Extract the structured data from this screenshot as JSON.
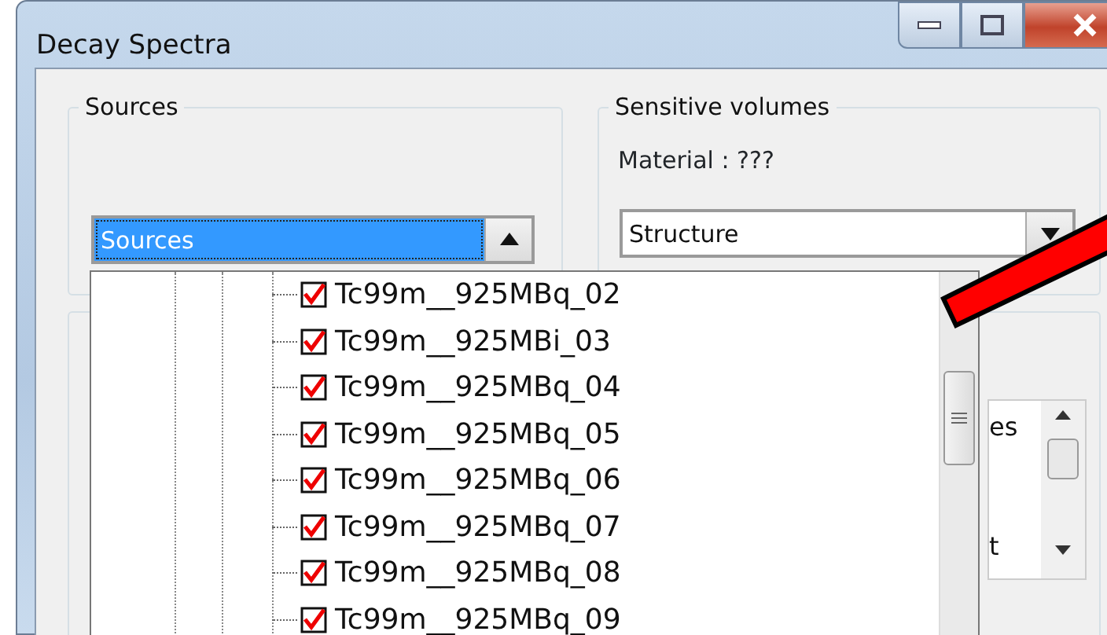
{
  "window": {
    "title": "Decay Spectra"
  },
  "sources_group": {
    "title": "Sources",
    "combo": {
      "value": "Sources",
      "expanded": true
    }
  },
  "sensitive_volumes": {
    "title": "Sensitive volumes",
    "material": "Material : ???",
    "combo": {
      "value": "Structure"
    }
  },
  "dropdown_items": [
    {
      "label": "Tc99m__925MBq_02",
      "checked": true
    },
    {
      "label": "Tc99m__925MBi_03",
      "checked": true
    },
    {
      "label": "Tc99m__925MBq_04",
      "checked": true
    },
    {
      "label": "Tc99m__925MBq_05",
      "checked": true
    },
    {
      "label": "Tc99m__925MBq_06",
      "checked": true
    },
    {
      "label": "Tc99m__925MBq_07",
      "checked": true
    },
    {
      "label": "Tc99m__925MBq_08",
      "checked": true
    },
    {
      "label": "Tc99m__925MBq_09",
      "checked": true
    }
  ],
  "hidden_list_fragments": [
    "es",
    "t"
  ]
}
